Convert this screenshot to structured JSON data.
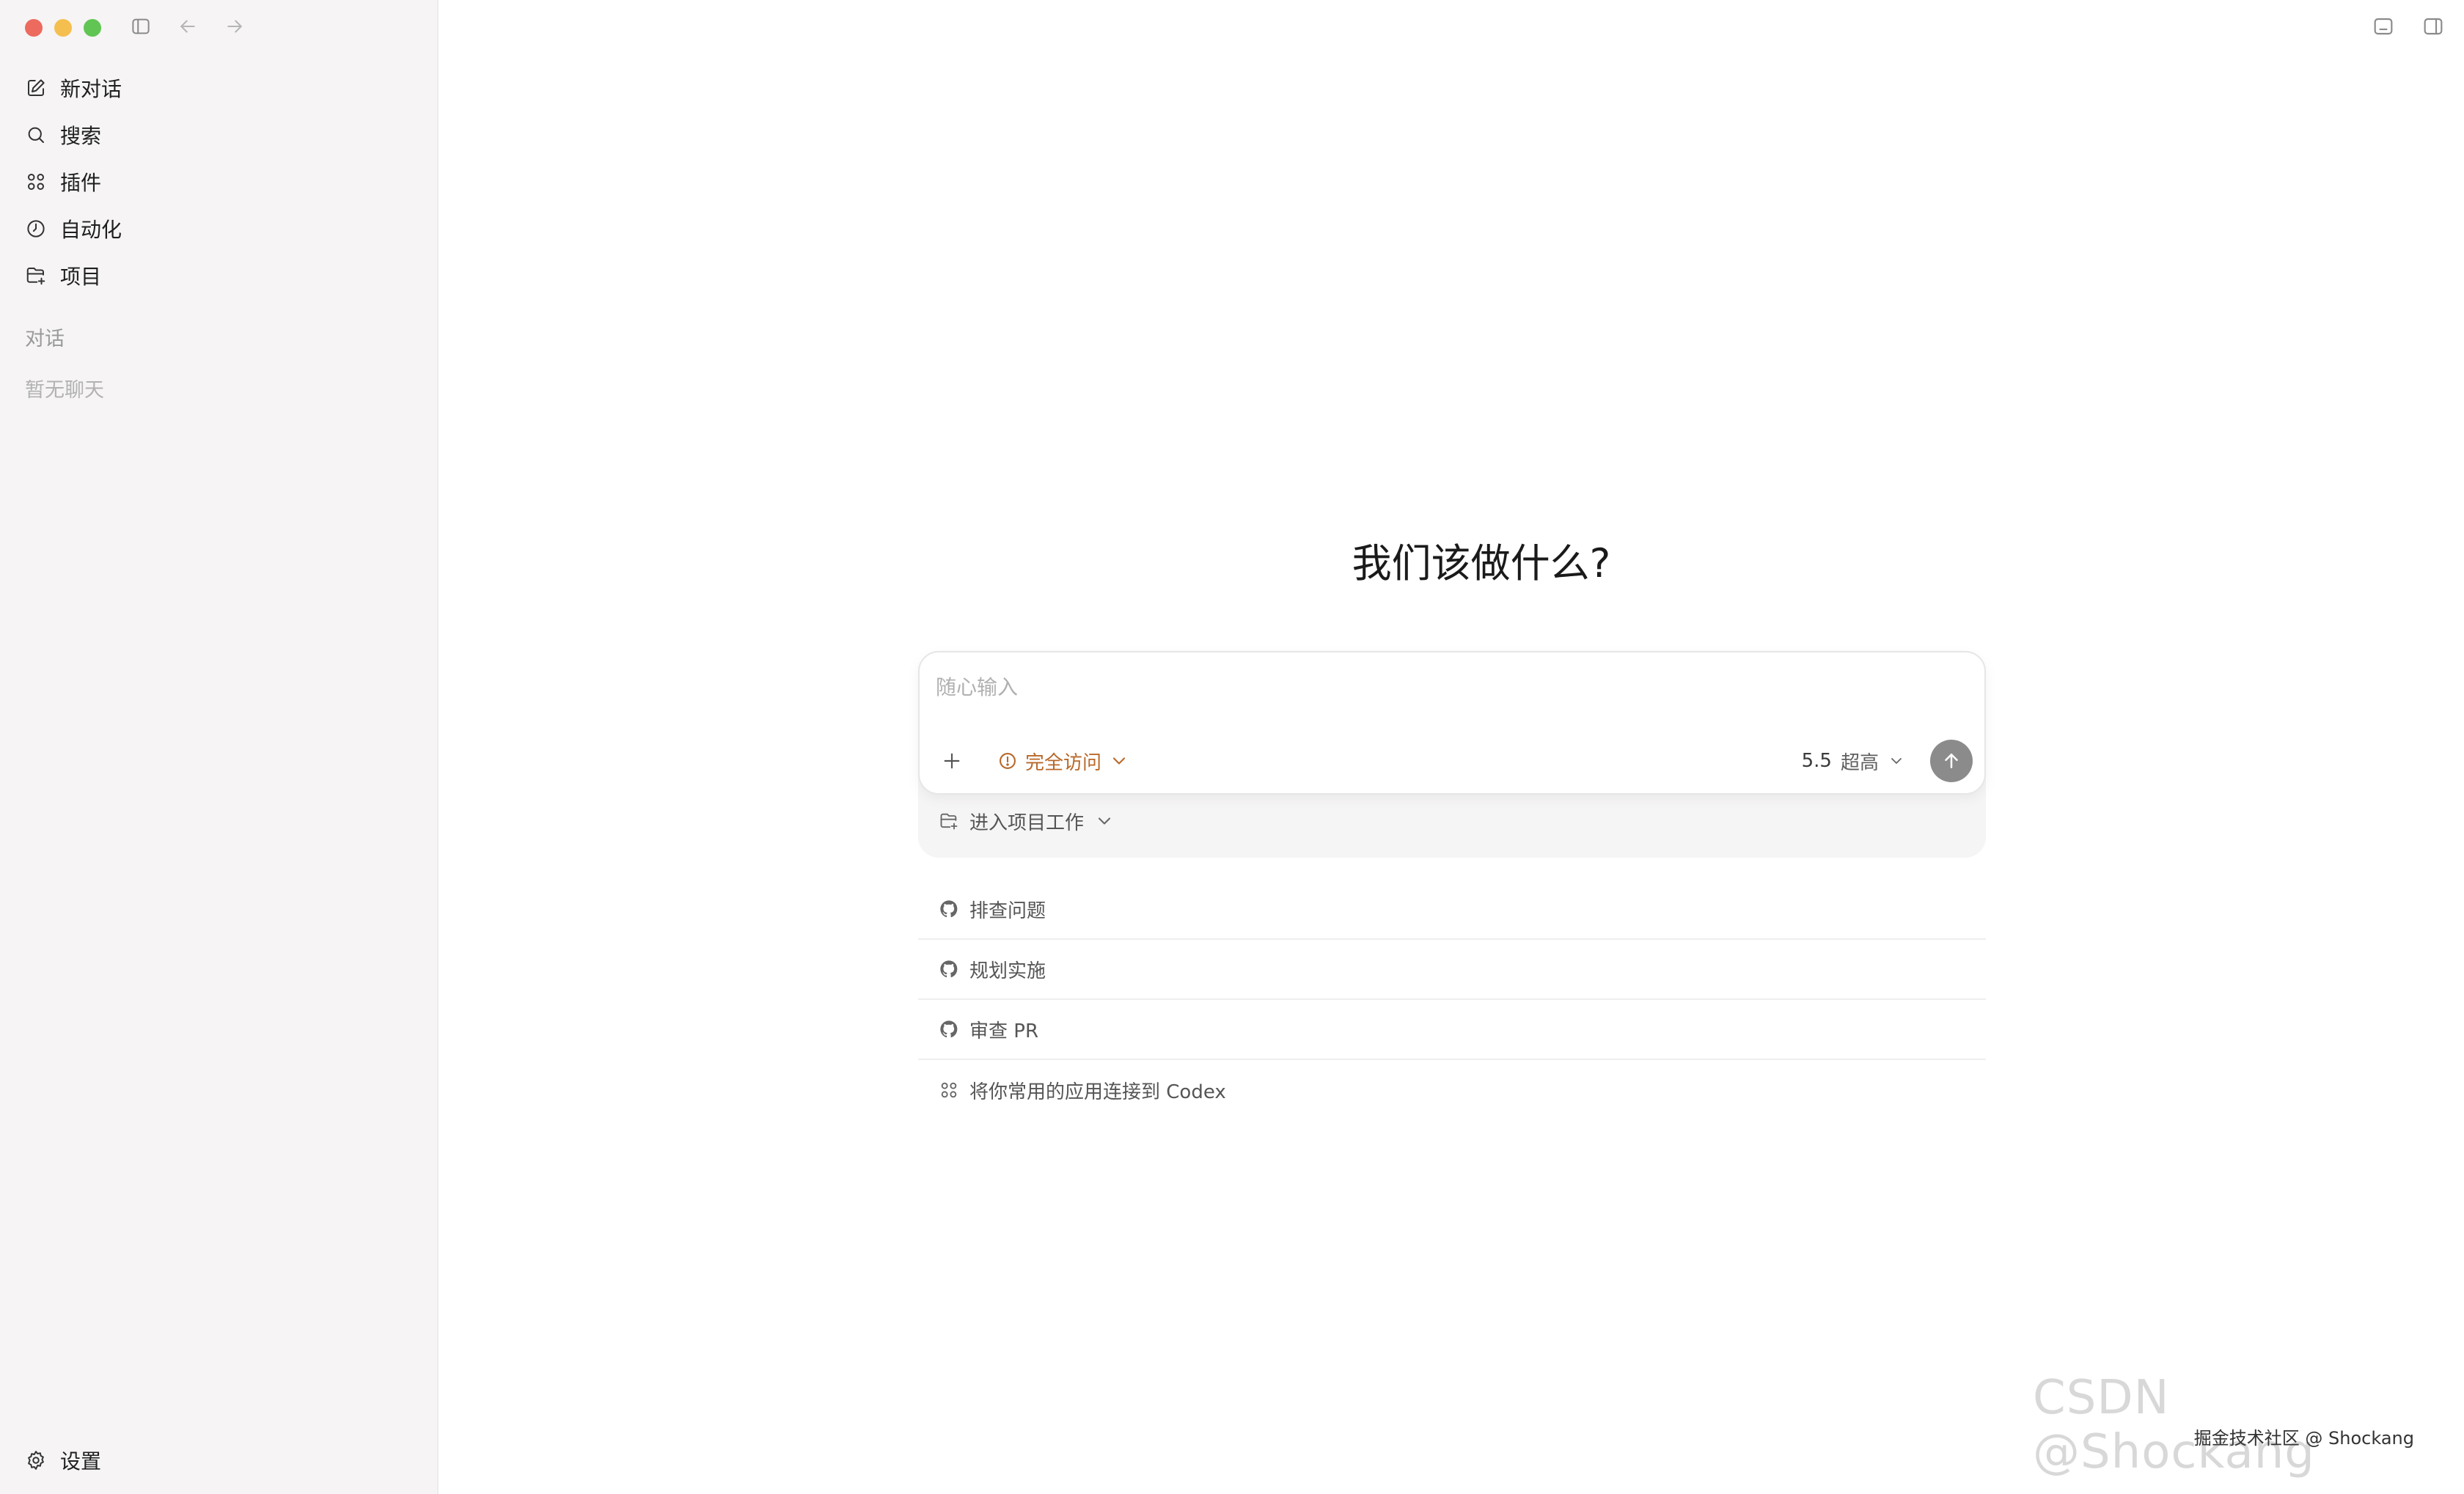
{
  "sidebar": {
    "nav": [
      {
        "label": "新对话",
        "icon": "edit-icon"
      },
      {
        "label": "搜索",
        "icon": "search-icon"
      },
      {
        "label": "插件",
        "icon": "grid-icon"
      },
      {
        "label": "自动化",
        "icon": "clock-icon"
      },
      {
        "label": "项目",
        "icon": "folder-plus-icon"
      }
    ],
    "section_label": "对话",
    "empty_label": "暂无聊天",
    "settings_label": "设置"
  },
  "main": {
    "headline": "我们该做什么?",
    "composer": {
      "placeholder": "随心输入",
      "access_label": "完全访问",
      "model_version": "5.5",
      "model_quality": "超高"
    },
    "project_label": "进入项目工作",
    "suggestions": [
      {
        "label": "排查问题",
        "icon": "github-icon"
      },
      {
        "label": "规划实施",
        "icon": "github-icon"
      },
      {
        "label": "审查 PR",
        "icon": "github-icon"
      },
      {
        "label": "将你常用的应用连接到 Codex",
        "icon": "grid-icon"
      }
    ]
  },
  "watermark": {
    "big": "CSDN @Shockang",
    "small": "掘金技术社区 @ Shockang"
  },
  "colors": {
    "sidebar_bg": "#f6f4f4",
    "accent_orange": "#b8682a",
    "send_button": "#8b8b8b"
  }
}
